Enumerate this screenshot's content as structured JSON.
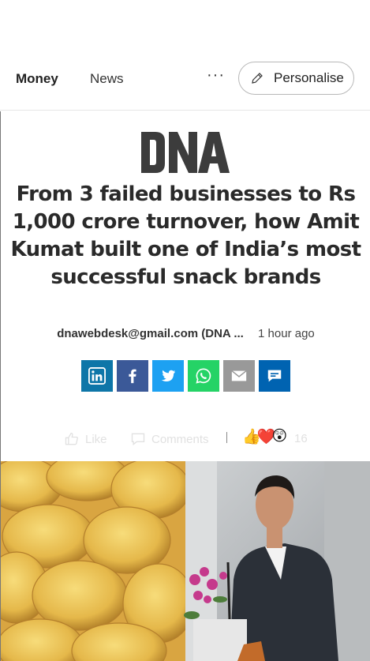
{
  "topbar": {
    "tabs": [
      "Money",
      "News"
    ],
    "more_label": "···",
    "personalise_label": "Personalise"
  },
  "article": {
    "source": "DNA",
    "headline": "From 3 failed businesses to Rs 1,000 crore turnover, how Amit Kumat built one of India’s most successful snack brands",
    "author": "dnawebdesk@gmail.com (DNA ...",
    "time": "1 hour ago",
    "share": [
      {
        "icon": "linkedin-icon",
        "color": "#0e76a8"
      },
      {
        "icon": "facebook-icon",
        "color": "#3b5998"
      },
      {
        "icon": "twitter-icon",
        "color": "#1da1f2"
      },
      {
        "icon": "whatsapp-icon",
        "color": "#25d366"
      },
      {
        "icon": "mail-icon",
        "color": "#999999"
      },
      {
        "icon": "comment-icon",
        "color": "#0063b1"
      }
    ]
  },
  "social": {
    "like_label": "Like",
    "comments_label": "Comments",
    "reaction_count": "16"
  }
}
